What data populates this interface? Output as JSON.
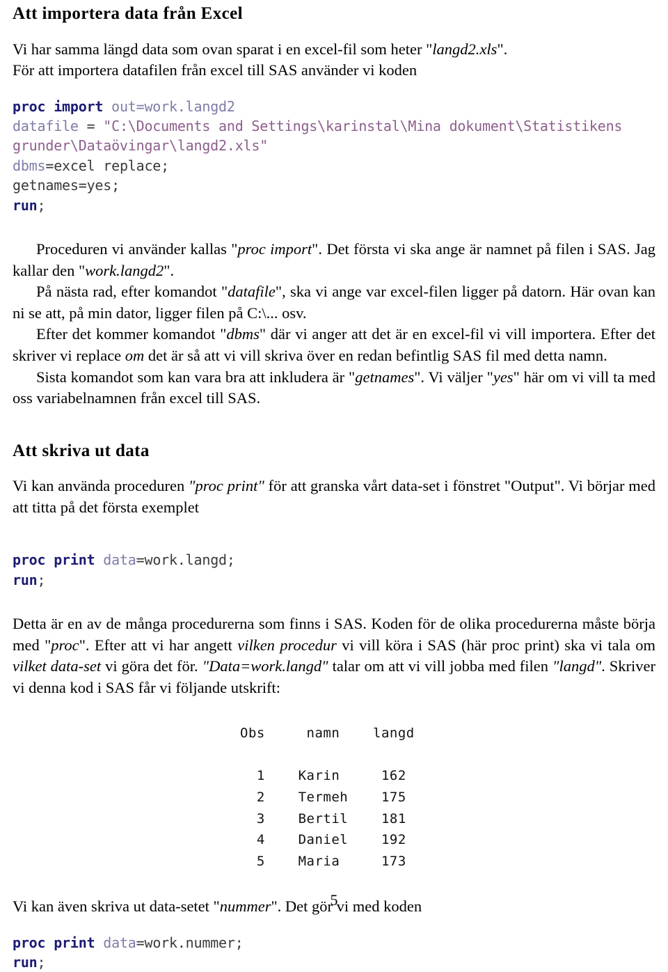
{
  "document": {
    "page_number": "5",
    "sections": [
      {
        "id": "import-section",
        "heading": "Att importera data från Excel"
      },
      {
        "id": "output-section",
        "heading": "Att skriva ut data"
      }
    ]
  },
  "intro": {
    "line1_a": "Vi har samma längd data som ovan sparat i en excel-fil som heter \"",
    "line1_em": "langd2.xls",
    "line1_b": "\".",
    "line2": "För att importera datafilen från excel till SAS använder vi koden"
  },
  "code_import": {
    "kw1": "proc import",
    "opt1": " out=work.langd2",
    "opt2": "datafile",
    "plain2": " = ",
    "str2": "\"C:\\Documents and Settings\\karinstal\\Mina dokument\\Statistikens grunder\\Dataövingar\\langd2.xls\"",
    "opt3": "dbms",
    "plain3": "=excel replace;",
    "plain4": "getnames=yes;",
    "kw5": "run",
    "plain5": ";"
  },
  "para_import_1": {
    "t1": "Proceduren vi använder kallas \"",
    "em1": "proc import",
    "t2": "\". Det första vi ska ange är namnet på filen i SAS. Jag kallar den \"",
    "em2": "work.langd2",
    "t3": "\"."
  },
  "para_import_2": {
    "t1": "På nästa rad, efter komandot \"",
    "em1": "datafile",
    "t2": "\", ska vi ange var excel-filen ligger på datorn. Här ovan kan ni se att, på min dator, ligger filen på C:\\... osv."
  },
  "para_import_3": {
    "t1": "Efter det kommer komandot \"",
    "em1": "dbms",
    "t2": "\" där vi anger att det är en excel-fil vi vill importera. Efter det skriver vi replace ",
    "em2": "om",
    "t3": " det är så att vi vill skriva över en redan befintlig SAS fil med detta namn."
  },
  "para_import_4": {
    "t1": "Sista komandot som kan vara bra att inkludera är \"",
    "em1": "getnames",
    "t2": "\". Vi väljer \"",
    "em2": "yes",
    "t3": "\" här om vi vill ta med oss variabelnamnen från excel till SAS."
  },
  "para_output_1": {
    "t1": "Vi kan använda proceduren ",
    "em1": "\"proc print\"",
    "t2": " för att granska vårt data-set i fönstret \"Output\". Vi börjar med att titta på det första exemplet"
  },
  "code_print_langd": {
    "kw1": "proc print",
    "opt1": "data",
    "plain1": "=work.langd;",
    "kw2": "run",
    "plain2": ";"
  },
  "para_output_2": {
    "t1": "Detta är en av de många procedurerna som finns i SAS. Koden för de olika procedurerna måste börja med \"",
    "em1": "proc",
    "t2": "\". Efter att vi har angett ",
    "em2": "vilken procedur",
    "t3": " vi vill köra i SAS (här proc print) ska vi tala om ",
    "em3": "vilket data-set",
    "t4": " vi göra det för. ",
    "em4": "\"Data=work.langd\"",
    "t5": " talar om att vi vill jobba med filen ",
    "em5": "\"langd\"",
    "t6": ". Skriver vi denna kod i SAS får vi följande utskrift:"
  },
  "output_table": {
    "columns": [
      "Obs",
      "namn",
      "langd"
    ],
    "rows": [
      [
        "1",
        "Karin",
        "162"
      ],
      [
        "2",
        "Termeh",
        "175"
      ],
      [
        "3",
        "Bertil",
        "181"
      ],
      [
        "4",
        "Daniel",
        "192"
      ],
      [
        "5",
        "Maria",
        "173"
      ]
    ],
    "rendered": "Obs     namn    langd\n\n  1    Karin     162\n  2    Termeh    175\n  3    Bertil    181\n  4    Daniel    192\n  5    Maria     173"
  },
  "para_output_3": {
    "t1": "Vi kan även skriva ut data-setet \"",
    "em1": "nummer",
    "t2": "\". Det gör vi med koden"
  },
  "code_print_nummer": {
    "kw1": "proc print",
    "opt1": "data",
    "plain1": "=work.nummer;",
    "kw2": "run",
    "plain2": ";"
  },
  "colors": {
    "keyword": "#1c1c73",
    "option": "#7d7da8",
    "string": "#8c5f8c",
    "plain": "#3a3a3a",
    "text": "#000000",
    "background": "#ffffff"
  }
}
